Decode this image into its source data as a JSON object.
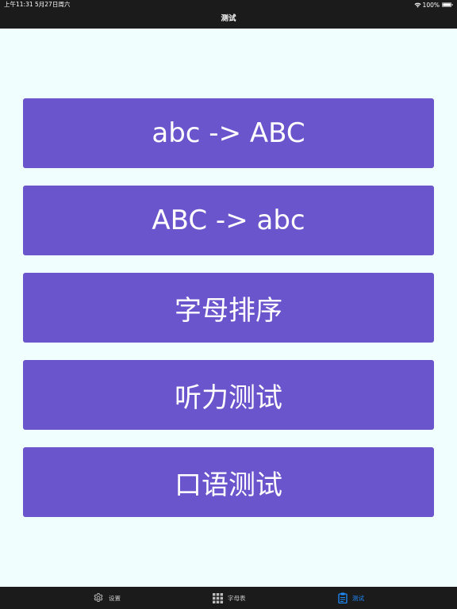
{
  "status_bar": {
    "time_date": "上午11:31   5月27日周六",
    "battery": "100%"
  },
  "nav": {
    "title": "测试"
  },
  "tests": [
    {
      "label": "abc -> ABC"
    },
    {
      "label": "ABC -> abc"
    },
    {
      "label": "字母排序"
    },
    {
      "label": "听力测试"
    },
    {
      "label": "口语测试"
    }
  ],
  "tabs": [
    {
      "label": "设置",
      "icon": "gear-icon"
    },
    {
      "label": "字母表",
      "icon": "grid-icon"
    },
    {
      "label": "测试",
      "icon": "clipboard-icon"
    }
  ],
  "colors": {
    "accent": "#1e8cff",
    "button": "#6a55cc",
    "background": "#f0fefe",
    "bars": "#1b1b1b"
  }
}
